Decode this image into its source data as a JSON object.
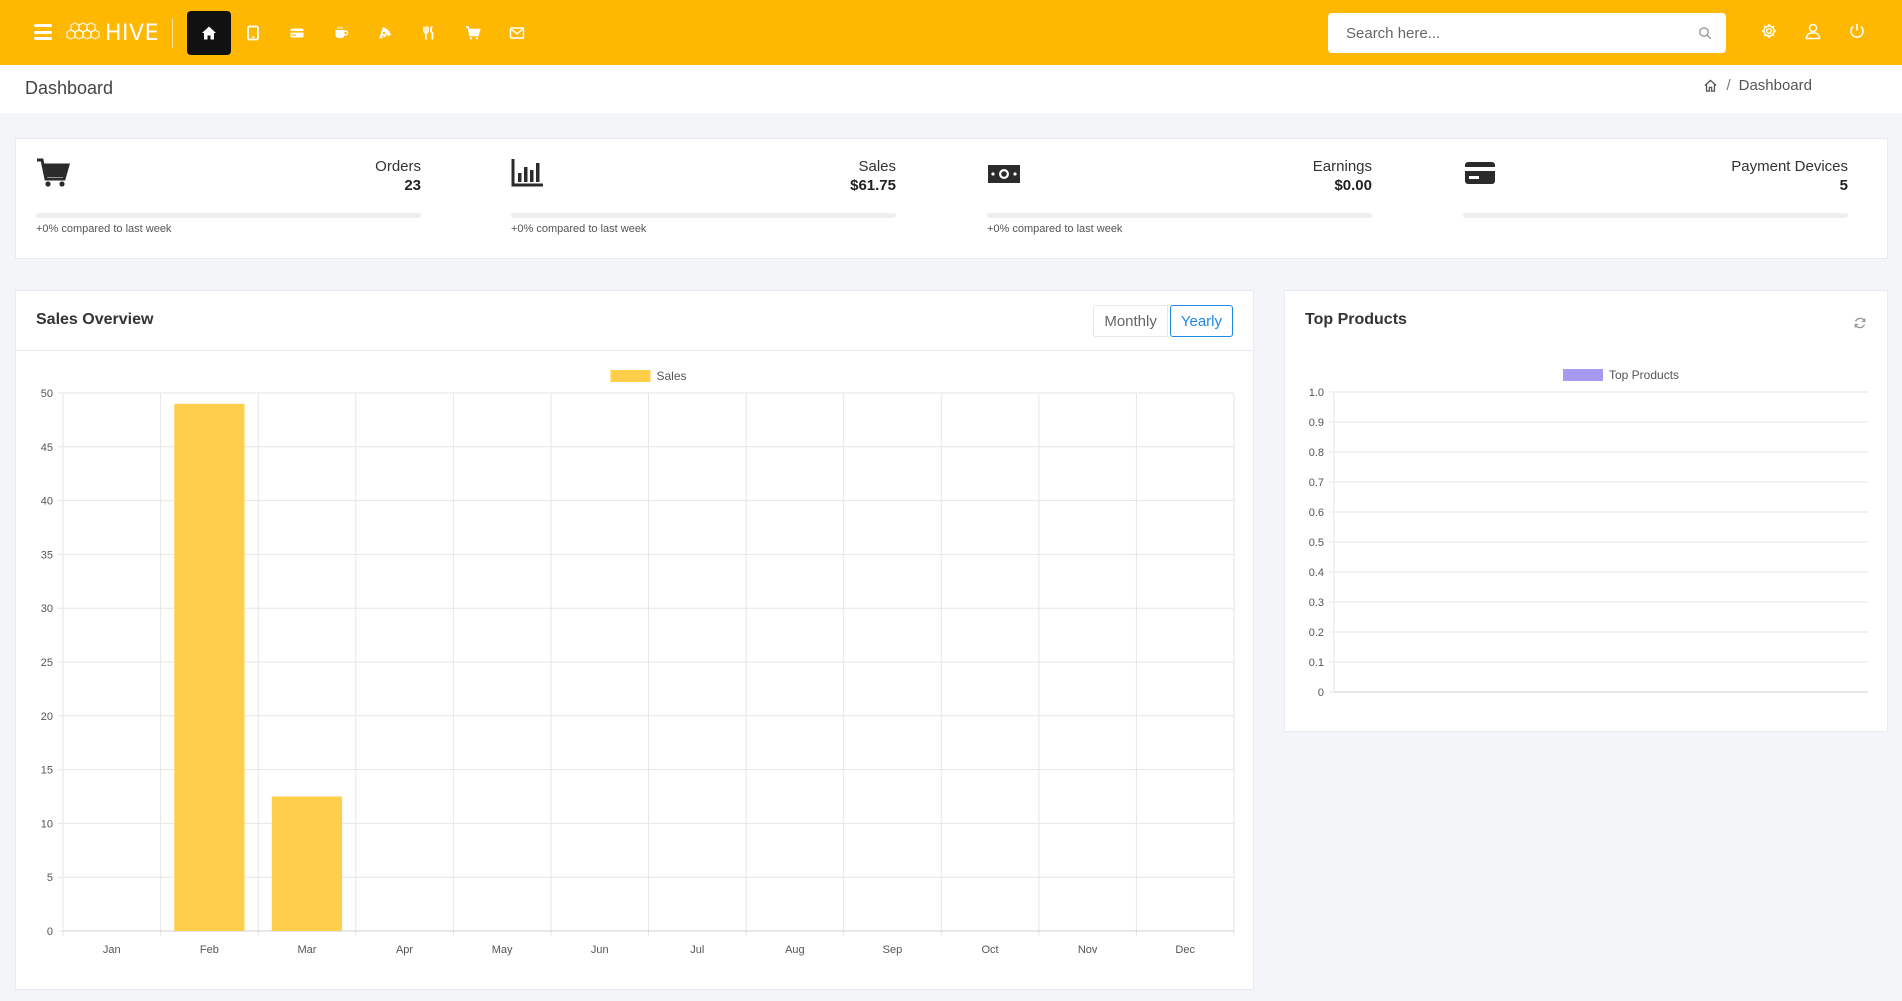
{
  "app": {
    "logo_text": "HIVE"
  },
  "nav": {
    "icons": [
      "home-icon",
      "tablet-icon",
      "card-icon",
      "coffee-icon",
      "pizza-icon",
      "utensils-icon",
      "cart-icon",
      "mail-icon"
    ],
    "active_index": 0
  },
  "search": {
    "placeholder": "Search here..."
  },
  "page": {
    "title": "Dashboard"
  },
  "breadcrumb": {
    "current": "Dashboard"
  },
  "stats": [
    {
      "icon": "cart-icon",
      "label": "Orders",
      "value": "23",
      "compare": "+0% compared to last week"
    },
    {
      "icon": "bar-chart-icon",
      "label": "Sales",
      "value": "$61.75",
      "compare": "+0% compared to last week"
    },
    {
      "icon": "money-icon",
      "label": "Earnings",
      "value": "$0.00",
      "compare": "+0% compared to last week"
    },
    {
      "icon": "credit-card-icon",
      "label": "Payment Devices",
      "value": "5",
      "compare": ""
    }
  ],
  "sales_overview": {
    "title": "Sales Overview",
    "monthly_label": "Monthly",
    "yearly_label": "Yearly",
    "selected": "Yearly"
  },
  "top_products": {
    "title": "Top Products"
  },
  "colors": {
    "accent": "#ffb802",
    "sales_bar": "#ffcf4c",
    "top_products": "#a59af0",
    "link": "#1e88e5"
  },
  "chart_data": [
    {
      "type": "bar",
      "categories": [
        "Jan",
        "Feb",
        "Mar",
        "Apr",
        "May",
        "Jun",
        "Jul",
        "Aug",
        "Sep",
        "Oct",
        "Nov",
        "Dec"
      ],
      "series": [
        {
          "name": "Sales",
          "values": [
            0,
            49,
            12.5,
            0,
            0,
            0,
            0,
            0,
            0,
            0,
            0,
            0
          ]
        }
      ],
      "yticks": [
        "0",
        "5",
        "10",
        "15",
        "20",
        "25",
        "30",
        "35",
        "40",
        "45",
        "50"
      ],
      "ylim": [
        0,
        50
      ],
      "grid": true,
      "legend": "top-center"
    },
    {
      "type": "bar",
      "categories": [],
      "series": [
        {
          "name": "Top Products",
          "values": []
        }
      ],
      "yticks": [
        "0",
        "0.1",
        "0.2",
        "0.3",
        "0.4",
        "0.5",
        "0.6",
        "0.7",
        "0.8",
        "0.9",
        "1.0"
      ],
      "ylim": [
        0,
        1
      ],
      "grid": true,
      "legend": "top-center"
    }
  ]
}
